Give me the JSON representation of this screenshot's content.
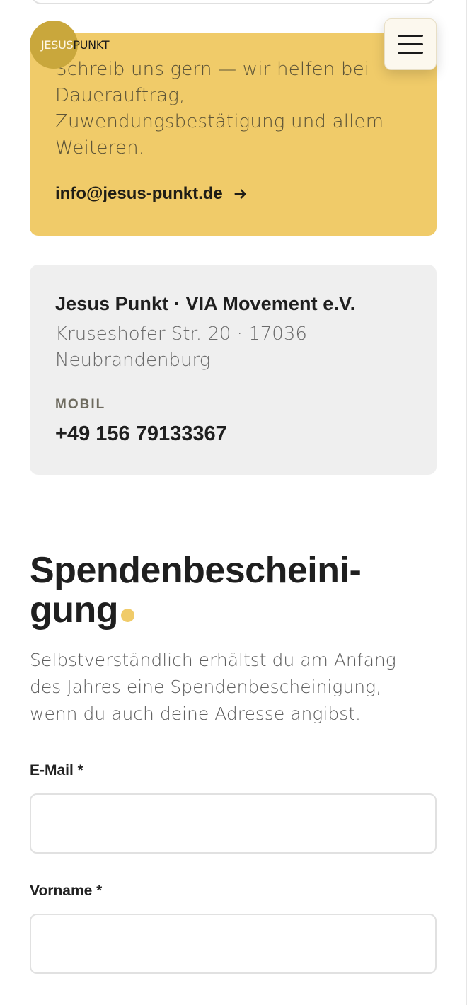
{
  "header": {
    "logo_word1": "JESUS",
    "logo_word2": "PUNKT",
    "menu_icon": "hamburger-menu-icon"
  },
  "contact_card": {
    "text": "Schreib uns gern — wir helfen bei Dauerauftrag, Zuwendungsbestätigung und allem Weiteren.",
    "email": "info@jesus-punkt.de",
    "email_icon": "arrow-right-icon",
    "background": "#f0cb69"
  },
  "address_card": {
    "org_name": "Jesus Punkt · VIA Movement e.V.",
    "address": "Kruseshofer Str. 20 · 17036 Neubrandenburg",
    "mobil_label": "MOBIL",
    "phone": "+49 156 79133367"
  },
  "donation_section": {
    "title_line1": "Spendenbescheini-",
    "title_line2": "gung",
    "accent_color": "#f0cb69",
    "description": "Selbstverständlich erhältst du am Anfang des Jahres eine Spendenbescheinigung, wenn du auch deine Adresse angibst."
  },
  "form": {
    "email_label": "E-Mail *",
    "email_value": "",
    "firstname_label": "Vorname *",
    "firstname_value": ""
  }
}
